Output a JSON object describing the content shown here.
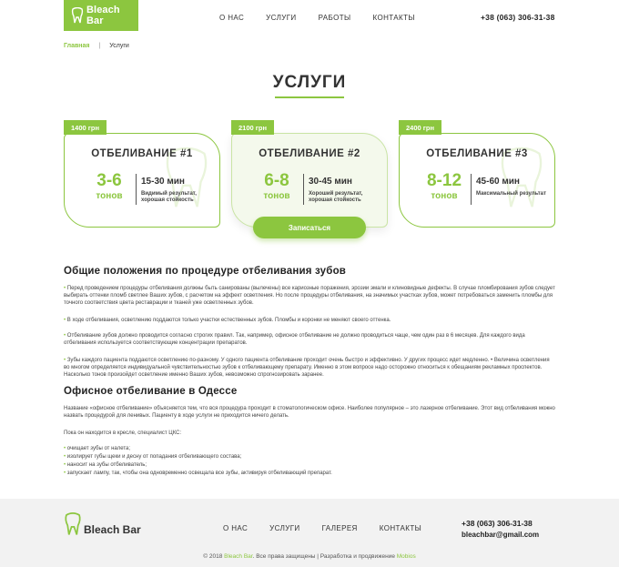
{
  "header": {
    "logo_text": "Bleach Bar",
    "nav": [
      "О НАС",
      "УСЛУГИ",
      "РАБОТЫ",
      "КОНТАКТЫ"
    ],
    "phone": "+38 (063) 306-31-38"
  },
  "breadcrumb": {
    "home": "Главная",
    "separator": "|",
    "current": "Услуги"
  },
  "page_title": "УСЛУГИ",
  "cards": [
    {
      "price": "1400 грн",
      "title": "ОТБЕЛИВАНИЕ #1",
      "tones": "3-6",
      "tones_unit": "тонов",
      "time": "15-30 мин",
      "desc": "Видимый результат, хорошая стойкость"
    },
    {
      "price": "2100 грн",
      "title": "ОТБЕЛИВАНИЕ #2",
      "tones": "6-8",
      "tones_unit": "тонов",
      "time": "30-45 мин",
      "desc": "Хороший результат, хорошая стойкость"
    },
    {
      "price": "2400 грн",
      "title": "ОТБЕЛИВАНИЕ #3",
      "tones": "8-12",
      "tones_unit": "тонов",
      "time": "45-60 мин",
      "desc": "Максимальный результат"
    }
  ],
  "cta_label": "Записаться",
  "section1": {
    "heading": "Общие положения по процедуре отбеливания зубов",
    "paragraphs": [
      "Перед проведением процедуры отбеливания должны быть санированы (вылечены) все кариозные поражения, эрозии эмали и клиновидные дефекты. В случае пломбирования зубов следует выбирать оттенки пломб светлее Ваших зубов, с расчетом на эффект осветления. Но после процедуры отбеливания, на значимых участках зубов, может потребоваться заменить пломбы для точного соответствия цвета реставрации и тканей уже осветленных зубов.",
      "В ходе отбеливания, осветлению поддаются только участки естественных зубов. Пломбы и коронки не меняют своего оттенка.",
      "Отбеливание зубов должно проводится согласно строгих правил. Так, например, офисное отбеливание не должно проводиться чаще, чем один раз в 6 месяцев. Для каждого вида отбеливания используется соответствующие концентрации препаратов.",
      "Зубы каждого пациента поддаются осветлению по-разному. У одного пациента отбеливание проходит очень быстро и эффективно. У других процесс идет медленно. • Величина осветления во многом определяется индивидуальной чувствительностью зубов к отбеливающему препарату. Именно в этом вопросе надо осторожно относиться к обещаниям рекламных проспектов. Насколько тонов произойдет осветление именно Ваших зубов, невозможно спрогнозировать заранее."
    ]
  },
  "section2": {
    "heading": "Офисное отбеливание в Одессе",
    "intro": "Название «офисное отбеливание» объясняется тем, что вся процедура проходит в стоматологическом офисе. Наиболее популярное – это лазерное отбеливание. Этот вид отбеливания можно назвать процедурой для ленивых. Пациенту в ходе услуги не приходится ничего делать.",
    "list_intro": "Пока он находится в кресле, специалист ЦКС:",
    "list": [
      "очищает зубы от налета;",
      "изолирует губы щеки и десну от попадания отбеливающего состава;",
      "наносит на зубы отбеливатель;",
      "запускает лампу, так, чтобы она одновременно освещала все зубы, активируя  отбеливающий препарат."
    ]
  },
  "footer": {
    "logo_text": "Bleach Bar",
    "nav": [
      "О НАС",
      "УСЛУГИ",
      "ГАЛЕРЕЯ",
      "КОНТАКТЫ"
    ],
    "phone": "+38 (063) 306-31-38",
    "email": "bleachbar@gmail.com",
    "copy_prefix": "© 2018 ",
    "copy_brand": "Bleach Bar",
    "copy_middle": ". Все права защищены | Разработка и продвижение ",
    "copy_dev": "Mobios"
  },
  "colors": {
    "accent": "#8cc63f",
    "footer_bg": "#f2f2f2",
    "text": "#333333"
  }
}
